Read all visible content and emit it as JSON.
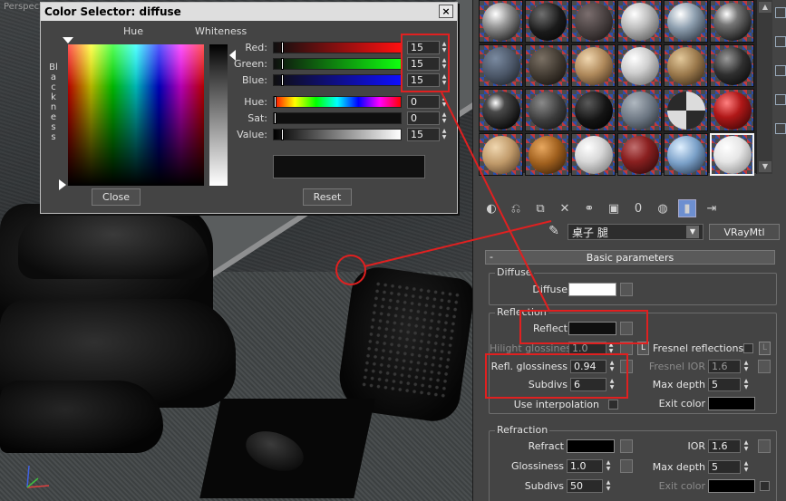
{
  "viewport": {
    "label": "Perspective"
  },
  "dialog": {
    "title": "Color Selector: diffuse",
    "close_symbol": "×",
    "hue_label": "Hue",
    "whiteness_label": "Whiteness",
    "blackness_label": "Blackness",
    "close_button": "Close",
    "reset_button": "Reset",
    "sliders": [
      {
        "label": "Red:",
        "value": "15",
        "level": 0.06
      },
      {
        "label": "Green:",
        "value": "15",
        "level": 0.06
      },
      {
        "label": "Blue:",
        "value": "15",
        "level": 0.06
      },
      {
        "label": "Hue:",
        "value": "0",
        "level": 0.0
      },
      {
        "label": "Sat:",
        "value": "0",
        "level": 0.0
      },
      {
        "label": "Value:",
        "value": "15",
        "level": 0.06
      }
    ]
  },
  "material": {
    "name": "桌子 腿",
    "type": "VRayMtl",
    "rollout_title": "Basic parameters",
    "rollout_toggle": "-"
  },
  "diffuse": {
    "group_title": "Diffuse",
    "label": "Diffuse",
    "color": "#ffffff"
  },
  "reflection": {
    "group_title": "Reflection",
    "reflect_label": "Reflect",
    "reflect_color": "#0f0f0f",
    "hilight_label": "Hilight glossiness",
    "hilight_value": "1.0",
    "lock_label": "L",
    "fresnel_label": "Fresnel reflections",
    "refl_gloss_label": "Refl. glossiness",
    "refl_gloss_value": "0.94",
    "fresnel_ior_label": "Fresnel IOR",
    "fresnel_ior_value": "1.6",
    "subdivs_label": "Subdivs",
    "subdivs_value": "6",
    "max_depth_label": "Max depth",
    "max_depth_value": "5",
    "use_interp_label": "Use interpolation",
    "exit_color_label": "Exit color",
    "exit_color": "#000000"
  },
  "refraction": {
    "group_title": "Refraction",
    "refract_label": "Refract",
    "refract_color": "#000000",
    "ior_label": "IOR",
    "ior_value": "1.6",
    "glossiness_label": "Glossiness",
    "glossiness_value": "1.0",
    "max_depth_label": "Max depth",
    "max_depth_value": "5",
    "subdivs_label": "Subdivs",
    "subdivs_value": "50",
    "exit_color_label": "Exit color",
    "exit_color": "#000000"
  },
  "toolbar": {
    "icons": [
      "get-material-icon",
      "put-to-scene-icon",
      "assign-material-icon",
      "reset-map-icon",
      "make-unique-icon",
      "put-to-library-icon",
      "material-effects-channel-icon",
      "show-map-in-viewport-icon",
      "show-end-result-icon",
      "go-to-parent-icon"
    ],
    "reset_glyph": "✕",
    "channel_glyph": "0"
  },
  "colors": {
    "annotation_red": "#e02020",
    "active_toolbar": "#6d8fd0"
  }
}
